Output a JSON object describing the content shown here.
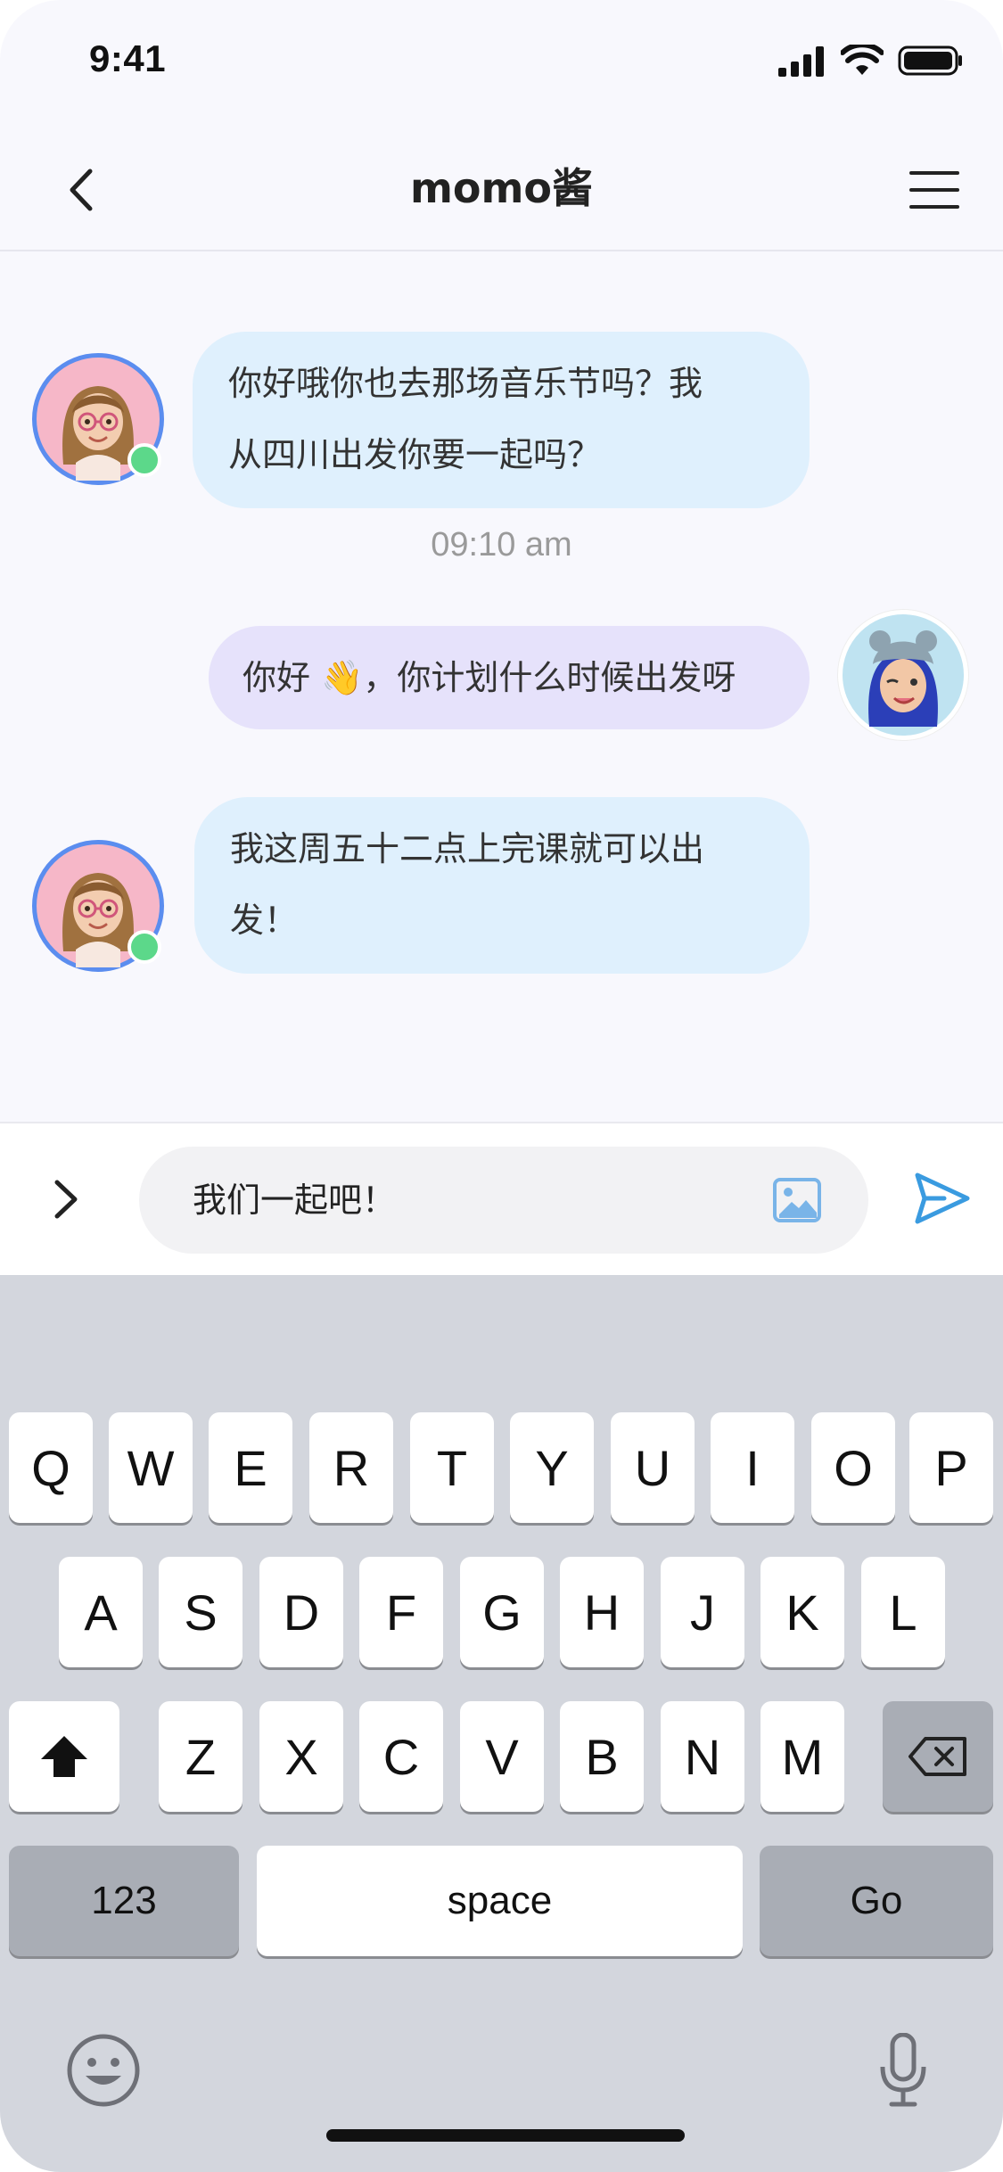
{
  "status_bar": {
    "time": "9:41"
  },
  "header": {
    "title": "momo酱"
  },
  "messages": [
    {
      "side": "incoming",
      "text": "你好哦你也去那场音乐节吗？我从四川出发你要一起吗？",
      "line1": "你好哦你也去那场音乐节吗？我",
      "line2": "从四川出发你要一起吗？"
    },
    {
      "timestamp": "09:10 am"
    },
    {
      "side": "outgoing",
      "text": "你好 👋，你计划什么时候出发呀"
    },
    {
      "side": "incoming",
      "text": "我这周五十二点上完课就可以出发！",
      "line1": "我这周五十二点上完课就可以出",
      "line2": "发！"
    }
  ],
  "input": {
    "value": "我们一起吧！"
  },
  "keyboard": {
    "row1": [
      "Q",
      "W",
      "E",
      "R",
      "T",
      "Y",
      "U",
      "I",
      "O",
      "P"
    ],
    "row2": [
      "A",
      "S",
      "D",
      "F",
      "G",
      "H",
      "J",
      "K",
      "L"
    ],
    "row3": [
      "Z",
      "X",
      "C",
      "V",
      "B",
      "N",
      "M"
    ],
    "numbers_label": "123",
    "space_label": "space",
    "go_label": "Go"
  },
  "colors": {
    "incoming_bubble": "#dff0fd",
    "outgoing_bubble": "#e6e2fb",
    "online_dot": "#5cd88a",
    "send_icon": "#3a9be0"
  },
  "icons": [
    "back-chevron-icon",
    "menu-icon",
    "signal-icon",
    "wifi-icon",
    "battery-icon",
    "expand-chevron-icon",
    "image-icon",
    "send-icon",
    "shift-icon",
    "delete-icon",
    "emoji-icon",
    "microphone-icon"
  ]
}
